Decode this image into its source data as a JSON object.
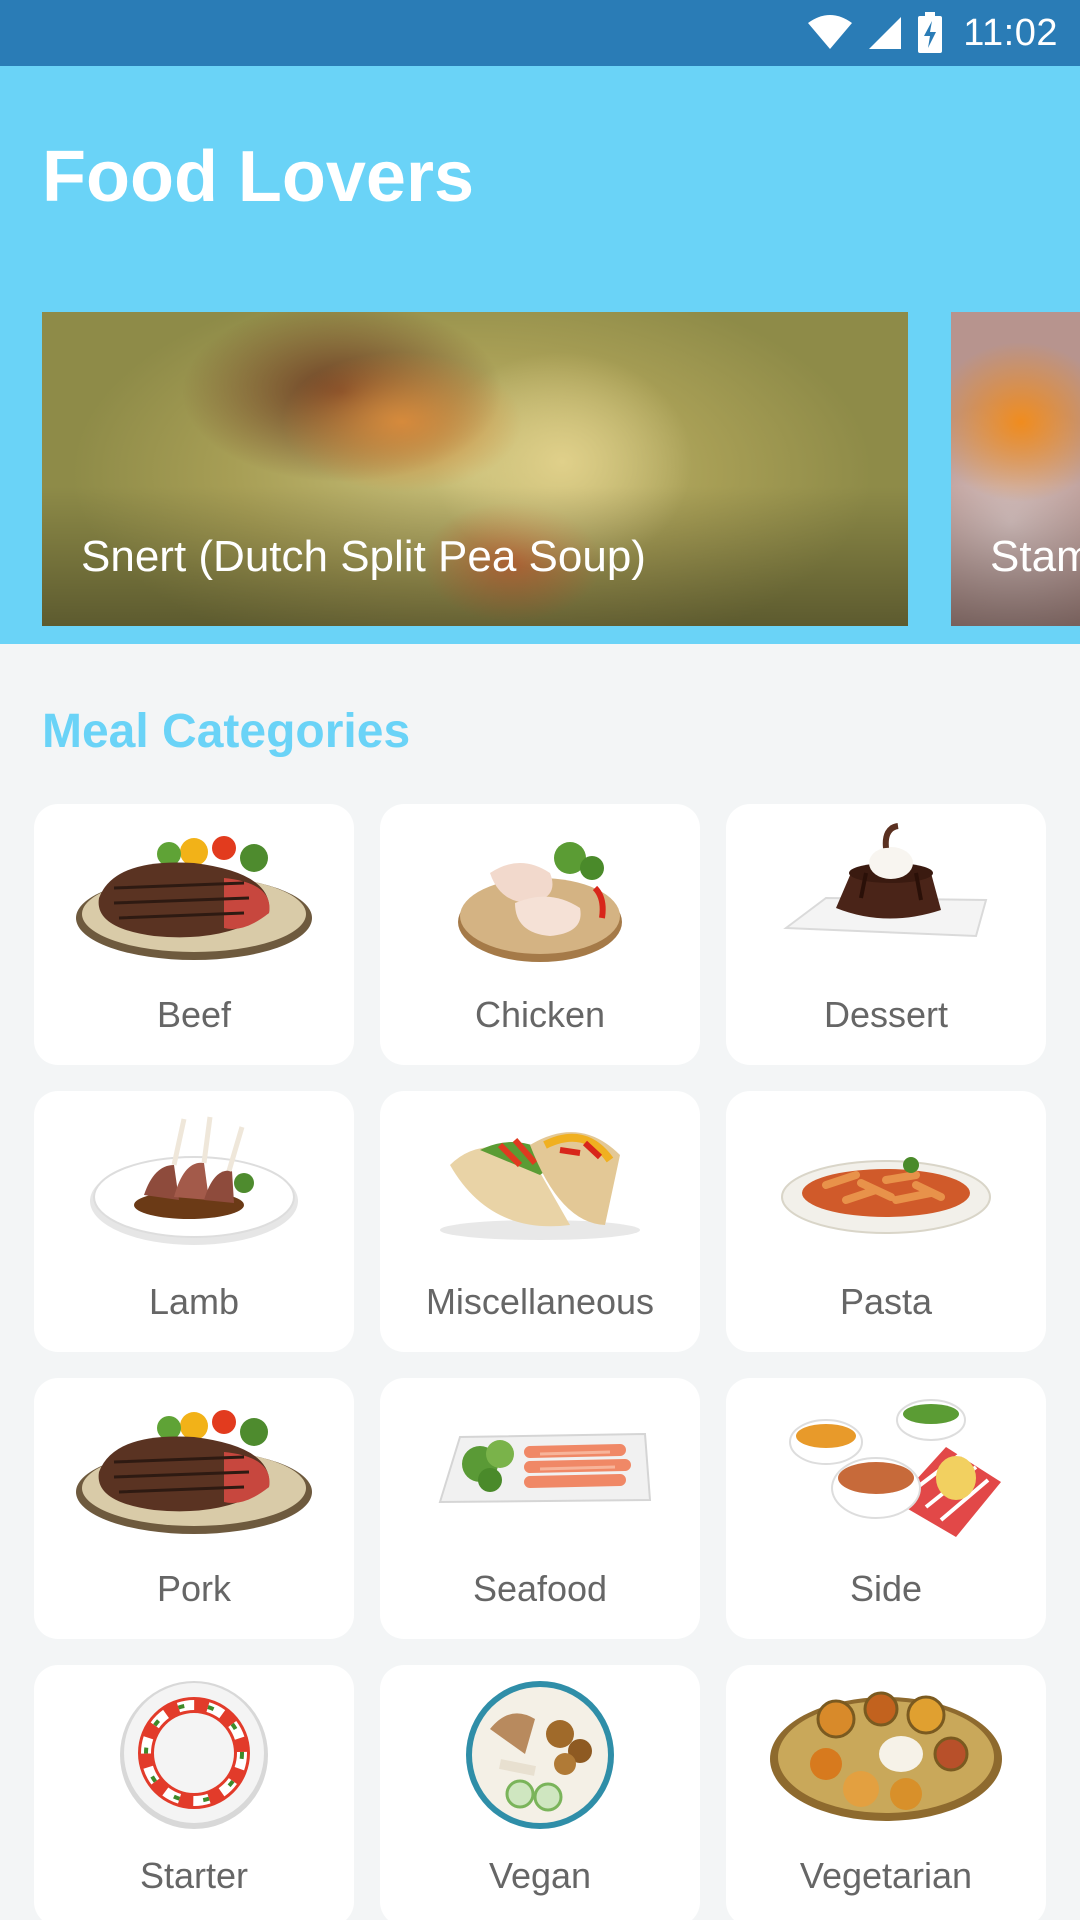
{
  "status_bar": {
    "time": "11:02"
  },
  "app": {
    "title": "Food Lovers"
  },
  "carousel": {
    "slides": [
      {
        "title": "Snert (Dutch Split Pea Soup)"
      },
      {
        "title": "Stam"
      }
    ]
  },
  "categories": {
    "title": "Meal Categories",
    "items": [
      {
        "label": "Beef"
      },
      {
        "label": "Chicken"
      },
      {
        "label": "Dessert"
      },
      {
        "label": "Lamb"
      },
      {
        "label": "Miscellaneous"
      },
      {
        "label": "Pasta"
      },
      {
        "label": "Pork"
      },
      {
        "label": "Seafood"
      },
      {
        "label": "Side"
      },
      {
        "label": "Starter"
      },
      {
        "label": "Vegan"
      },
      {
        "label": "Vegetarian"
      }
    ]
  },
  "colors": {
    "status_bar": "#2A7CB6",
    "header": "#6AD3F7",
    "background": "#F3F5F6",
    "card": "#FFFFFF",
    "label": "#666666"
  }
}
